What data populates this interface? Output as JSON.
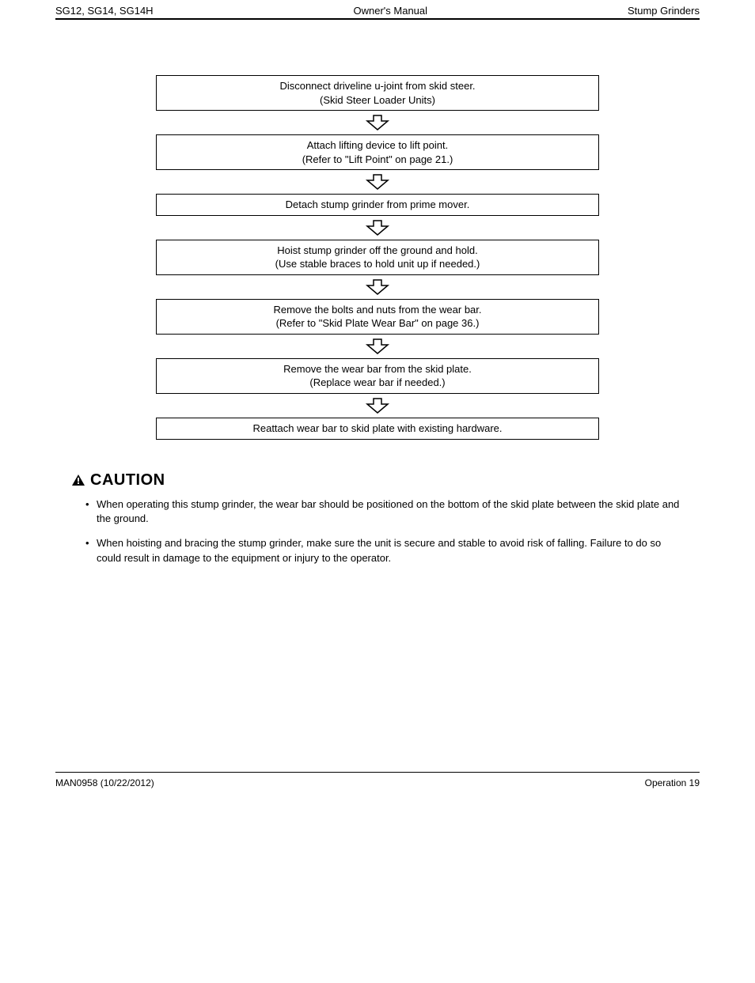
{
  "header": {
    "left": "SG12, SG14, SG14H",
    "center": "Owner's Manual",
    "right": "Stump Grinders"
  },
  "flow": {
    "steps": [
      "Disconnect driveline u-joint from skid steer.\n(Skid Steer Loader Units)",
      "Attach lifting device to lift point.\n(Refer to \"Lift Point\" on page 21.)",
      "Detach stump grinder from prime mover.",
      "Hoist stump grinder off the ground and hold.\n(Use stable braces to hold unit up if needed.)",
      "Remove the bolts and nuts from the wear bar.\n(Refer to \"Skid Plate Wear Bar\" on page 36.)",
      "Remove the wear bar from the skid plate.\n(Replace wear bar if needed.)",
      "Reattach wear bar to skid plate with existing hardware."
    ]
  },
  "caution": {
    "label": "CAUTION",
    "bullets": [
      "When operating this stump grinder, the wear bar should be positioned on the bottom of the skid plate between the skid plate and the ground.",
      "When hoisting and bracing the stump grinder, make sure the unit is secure and stable to avoid risk of falling. Failure to do so could result in damage to the equipment or injury to the operator."
    ]
  },
  "footer": {
    "left": "MAN0958 (10/22/2012)",
    "right": "Operation   19"
  }
}
